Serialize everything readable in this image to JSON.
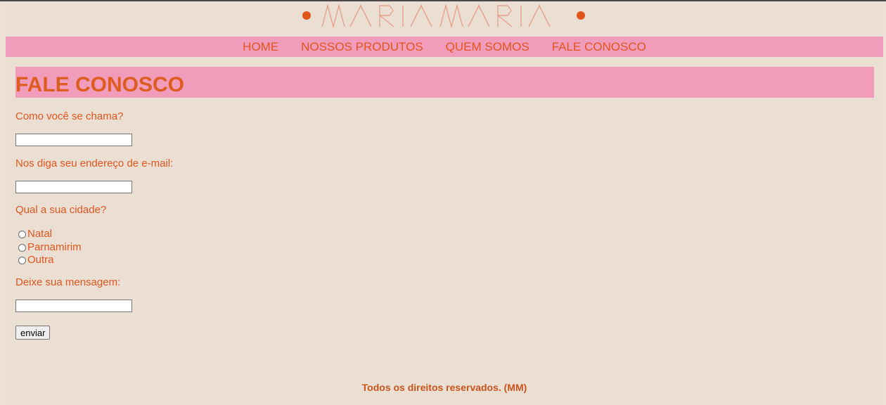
{
  "brand": {
    "logo_text": "MARIAMARIA",
    "primary_color": "#e0551c",
    "accent_color": "#f29cbc",
    "background_color": "#ebdfd3"
  },
  "nav": {
    "items": [
      {
        "label": "HOME"
      },
      {
        "label": "NOSSOS PRODUTOS"
      },
      {
        "label": "QUEM SOMOS"
      },
      {
        "label": "FALE CONOSCO"
      }
    ]
  },
  "page": {
    "title": "FALE CONOSCO"
  },
  "form": {
    "name_label": "Como você se chama?",
    "name_value": "",
    "email_label": "Nos diga seu endereço de e-mail:",
    "email_value": "",
    "city_label": "Qual a sua cidade?",
    "city_options": [
      "Natal",
      "Parnamirim",
      "Outra"
    ],
    "message_label": "Deixe sua mensagem:",
    "message_value": "",
    "submit_label": "enviar"
  },
  "footer": {
    "text": "Todos os direitos reservados. (MM)"
  }
}
